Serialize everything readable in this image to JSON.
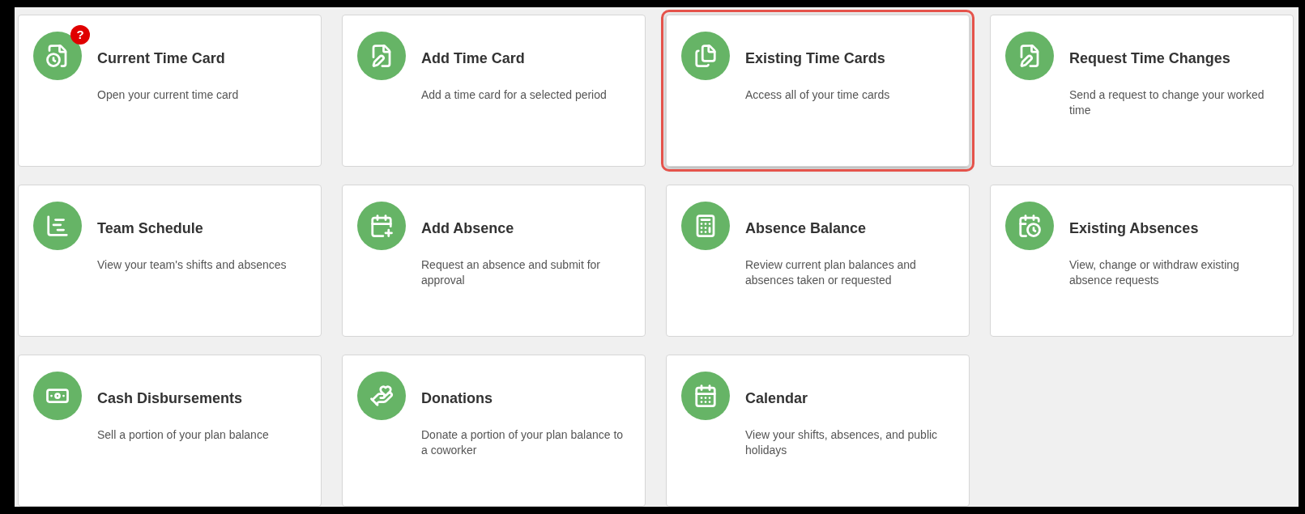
{
  "tiles": [
    {
      "title": "Current Time Card",
      "description": "Open your current time card",
      "badge": "?",
      "highlighted": false
    },
    {
      "title": "Add Time Card",
      "description": "Add a time card for a selected period",
      "highlighted": false
    },
    {
      "title": "Existing Time Cards",
      "description": "Access all of your time cards",
      "highlighted": true
    },
    {
      "title": "Request Time Changes",
      "description": "Send a request to change your worked time",
      "highlighted": false
    },
    {
      "title": "Team Schedule",
      "description": "View your team's shifts and absences",
      "highlighted": false
    },
    {
      "title": "Add Absence",
      "description": "Request an absence and submit for approval",
      "highlighted": false
    },
    {
      "title": "Absence Balance",
      "description": "Review current plan balances and absences taken or requested",
      "highlighted": false
    },
    {
      "title": "Existing Absences",
      "description": "View, change or withdraw existing absence requests",
      "highlighted": false
    },
    {
      "title": "Cash Disbursements",
      "description": "Sell a portion of your plan balance",
      "highlighted": false
    },
    {
      "title": "Donations",
      "description": "Donate a portion of your plan balance to a coworker",
      "highlighted": false
    },
    {
      "title": "Calendar",
      "description": "View your shifts, absences, and public holidays",
      "highlighted": false
    }
  ]
}
